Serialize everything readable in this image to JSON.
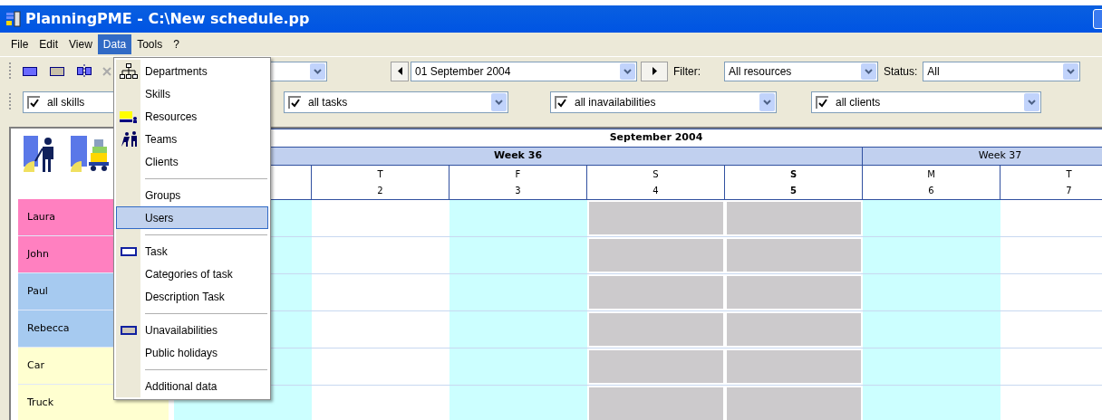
{
  "window": {
    "title": "PlanningPME - C:\\New schedule.pp"
  },
  "menu_bar": [
    {
      "label": "File",
      "selected": false
    },
    {
      "label": "Edit",
      "selected": false
    },
    {
      "label": "View",
      "selected": false
    },
    {
      "label": "Data",
      "selected": true
    },
    {
      "label": "Tools",
      "selected": false
    },
    {
      "label": "?",
      "selected": false
    }
  ],
  "data_menu": [
    {
      "kind": "item",
      "label": "Departments",
      "selected": false
    },
    {
      "kind": "item",
      "label": "Skills",
      "selected": false
    },
    {
      "kind": "item",
      "label": "Resources",
      "selected": false
    },
    {
      "kind": "item",
      "label": "Teams",
      "selected": false
    },
    {
      "kind": "item",
      "label": "Clients",
      "selected": false
    },
    {
      "kind": "separator"
    },
    {
      "kind": "item",
      "label": "Groups",
      "selected": false
    },
    {
      "kind": "item",
      "label": "Users",
      "selected": true
    },
    {
      "kind": "separator"
    },
    {
      "kind": "item",
      "label": "Task",
      "selected": false
    },
    {
      "kind": "item",
      "label": "Categories of task",
      "selected": false
    },
    {
      "kind": "item",
      "label": "Description Task",
      "selected": false
    },
    {
      "kind": "separator"
    },
    {
      "kind": "item",
      "label": "Unavailabilities",
      "selected": false
    },
    {
      "kind": "item",
      "label": "Public holidays",
      "selected": false
    },
    {
      "kind": "separator"
    },
    {
      "kind": "item",
      "label": "Additional data",
      "selected": false
    }
  ],
  "toolbar": {
    "date": "01 September 2004",
    "filter_label": "Filter:",
    "filter": "All resources",
    "status_label": "Status:",
    "status": "All"
  },
  "filters": [
    {
      "label": "all skills",
      "checked": true
    },
    {
      "label": "all tasks",
      "checked": true
    },
    {
      "label": "all inavailabilities",
      "checked": true
    },
    {
      "label": "all clients",
      "checked": true
    }
  ],
  "schedule": {
    "month": "September 2004",
    "weeks": [
      {
        "label": "Week 36",
        "current": true
      },
      {
        "label": "Week 37",
        "current": false
      }
    ],
    "days": [
      {
        "kind": "workday",
        "color": "#ccffff"
      },
      {
        "kind": "workday",
        "letter": "T",
        "number": "2",
        "color": "#ffffff",
        "today": false
      },
      {
        "kind": "workday",
        "letter": "F",
        "number": "3",
        "color": "#ccffff",
        "today": false
      },
      {
        "kind": "weekend",
        "letter": "S",
        "number": "4",
        "color": "#cccacc",
        "today": false
      },
      {
        "kind": "weekend",
        "letter": "S",
        "number": "5",
        "color": "#cccacc",
        "today": true
      },
      {
        "kind": "workday",
        "letter": "M",
        "number": "6",
        "color": "#ccffff",
        "today": false
      },
      {
        "kind": "workday",
        "letter": "T",
        "number": "7",
        "color": "#ffffff",
        "today": false
      }
    ],
    "resources": [
      {
        "name": "Laura",
        "color": "#ff80c0"
      },
      {
        "name": "John",
        "color": "#ff80c0"
      },
      {
        "name": "Paul",
        "color": "#a6caf0"
      },
      {
        "name": "Rebecca",
        "color": "#a6caf0"
      },
      {
        "name": "Car",
        "color": "#ffffd0"
      },
      {
        "name": "Truck",
        "color": "#ffffd0"
      }
    ]
  }
}
